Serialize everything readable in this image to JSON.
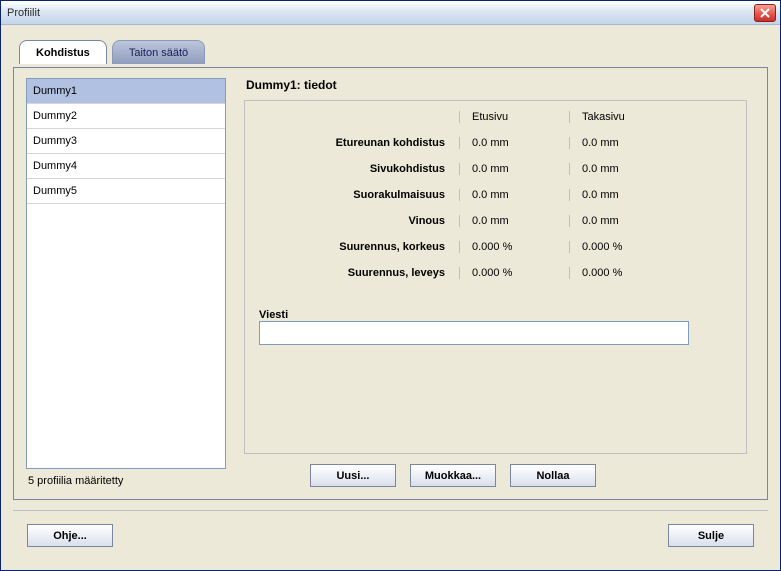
{
  "window": {
    "title": "Profiilit"
  },
  "tabs": [
    {
      "label": "Kohdistus",
      "active": true
    },
    {
      "label": "Taiton säätö",
      "active": false
    }
  ],
  "profiles": {
    "items": [
      {
        "label": "Dummy1",
        "selected": true
      },
      {
        "label": "Dummy2",
        "selected": false
      },
      {
        "label": "Dummy3",
        "selected": false
      },
      {
        "label": "Dummy4",
        "selected": false
      },
      {
        "label": "Dummy5",
        "selected": false
      }
    ],
    "count_text": "5 profiilia määritetty"
  },
  "detail": {
    "title": "Dummy1: tiedot",
    "columns": {
      "front": "Etusivu",
      "back": "Takasivu"
    },
    "rows": [
      {
        "label": "Etureunan kohdistus",
        "front": "0.0 mm",
        "back": "0.0 mm"
      },
      {
        "label": "Sivukohdistus",
        "front": "0.0 mm",
        "back": "0.0 mm"
      },
      {
        "label": "Suorakulmaisuus",
        "front": "0.0 mm",
        "back": "0.0 mm"
      },
      {
        "label": "Vinous",
        "front": "0.0 mm",
        "back": "0.0 mm"
      },
      {
        "label": "Suurennus, korkeus",
        "front": "0.000 %",
        "back": "0.000 %"
      },
      {
        "label": "Suurennus, leveys",
        "front": "0.000 %",
        "back": "0.000 %"
      }
    ],
    "message_label": "Viesti",
    "message_value": ""
  },
  "buttons": {
    "new": "Uusi...",
    "edit": "Muokkaa...",
    "reset": "Nollaa",
    "help": "Ohje...",
    "close": "Sulje"
  }
}
